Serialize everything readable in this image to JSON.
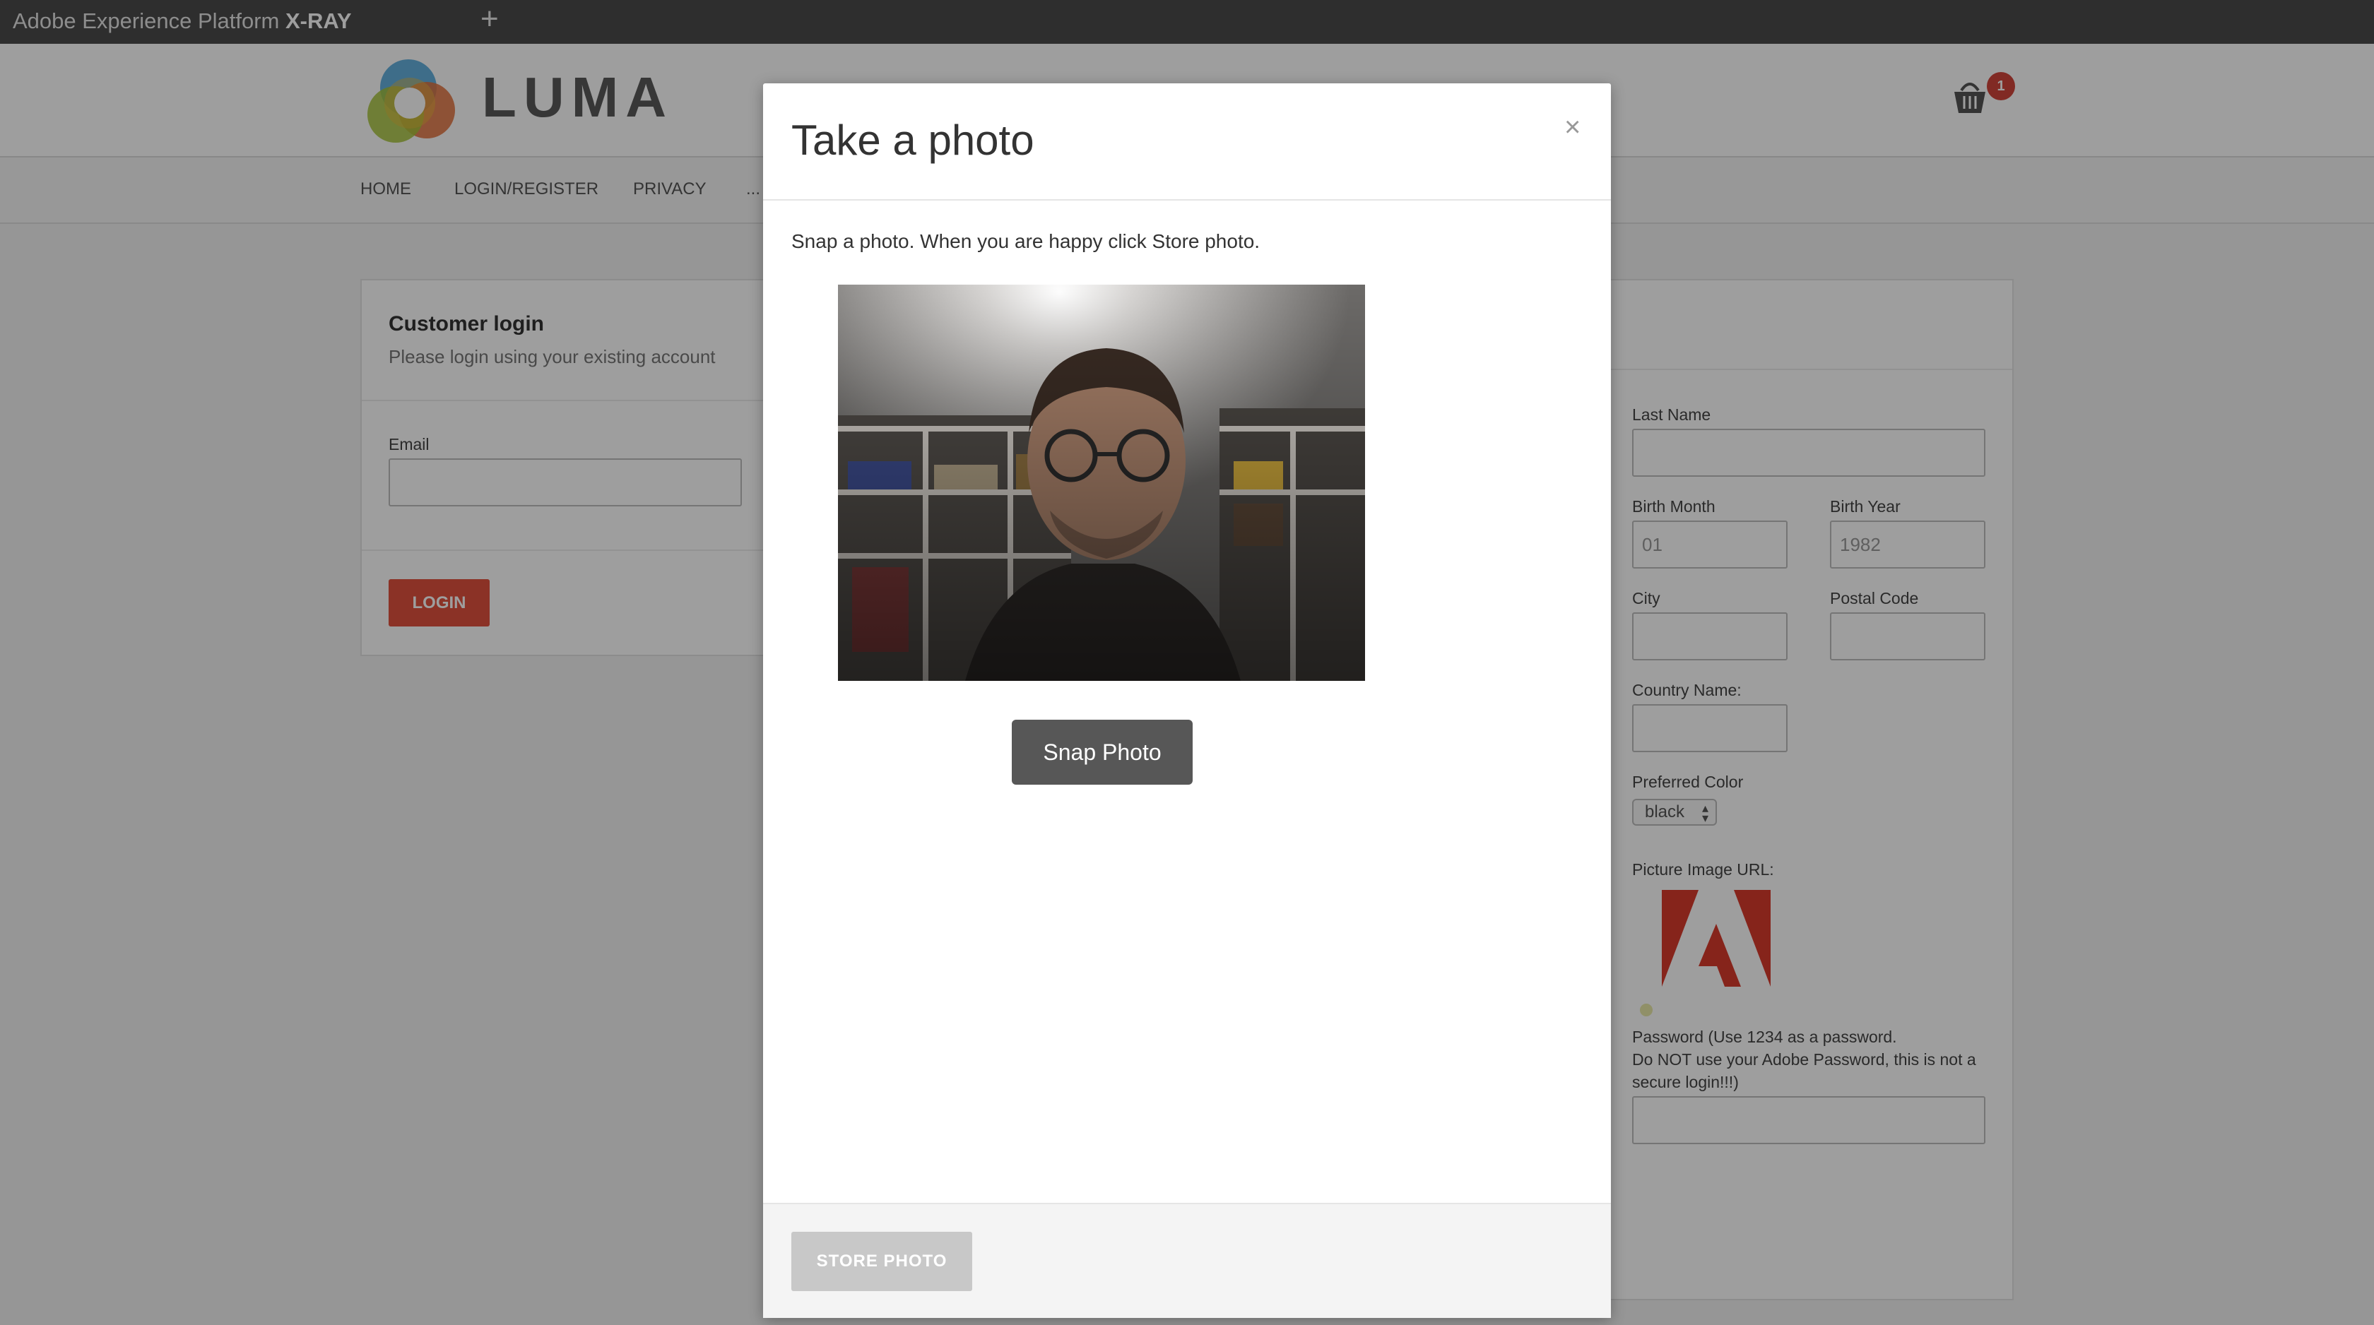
{
  "xray": {
    "title_plain": "Adobe Experience Platform ",
    "title_bold": "X-RAY",
    "add_tab": "+"
  },
  "header": {
    "logo_text": "LUMA",
    "cart_count": "1"
  },
  "nav": {
    "items": [
      "HOME",
      "LOGIN/REGISTER",
      "PRIVACY",
      "..."
    ]
  },
  "login_card": {
    "title": "Customer login",
    "subtitle": "Please login using your existing account",
    "email_label": "Email",
    "email_value": "",
    "login_button": "LOGIN"
  },
  "register_form": {
    "last_name_label": "Last Name",
    "last_name_value": "",
    "birth_month_label": "Birth Month",
    "birth_month_placeholder": "01",
    "birth_year_label": "Birth Year",
    "birth_year_placeholder": "1982",
    "city_label": "City",
    "postal_code_label": "Postal Code",
    "country_label": "Country Name:",
    "color_label": "Preferred Color",
    "color_value": "black",
    "picture_label": "Picture Image URL:",
    "password_label_line1": "Password (Use 1234 as a password.",
    "password_label_line2": "Do NOT use your Adobe Password, this is not a",
    "password_label_line3": "secure login!!!)"
  },
  "modal": {
    "title": "Take a photo",
    "close": "×",
    "instruction": "Snap a photo. When you are happy click Store photo.",
    "snap_button": "Snap Photo",
    "store_button": "STORE PHOTO"
  },
  "colors": {
    "accent_red": "#e1513e",
    "xray_bar": "#4b4b4b",
    "adobe_red": "#d83a2c"
  }
}
